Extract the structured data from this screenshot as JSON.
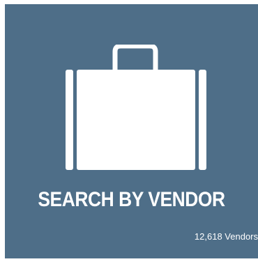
{
  "tile": {
    "icon": "briefcase-icon",
    "title": "SEARCH BY VENDOR",
    "count_label": "12,618 Vendors",
    "background_color": "#4e6e88",
    "icon_color": "#ffffff"
  }
}
